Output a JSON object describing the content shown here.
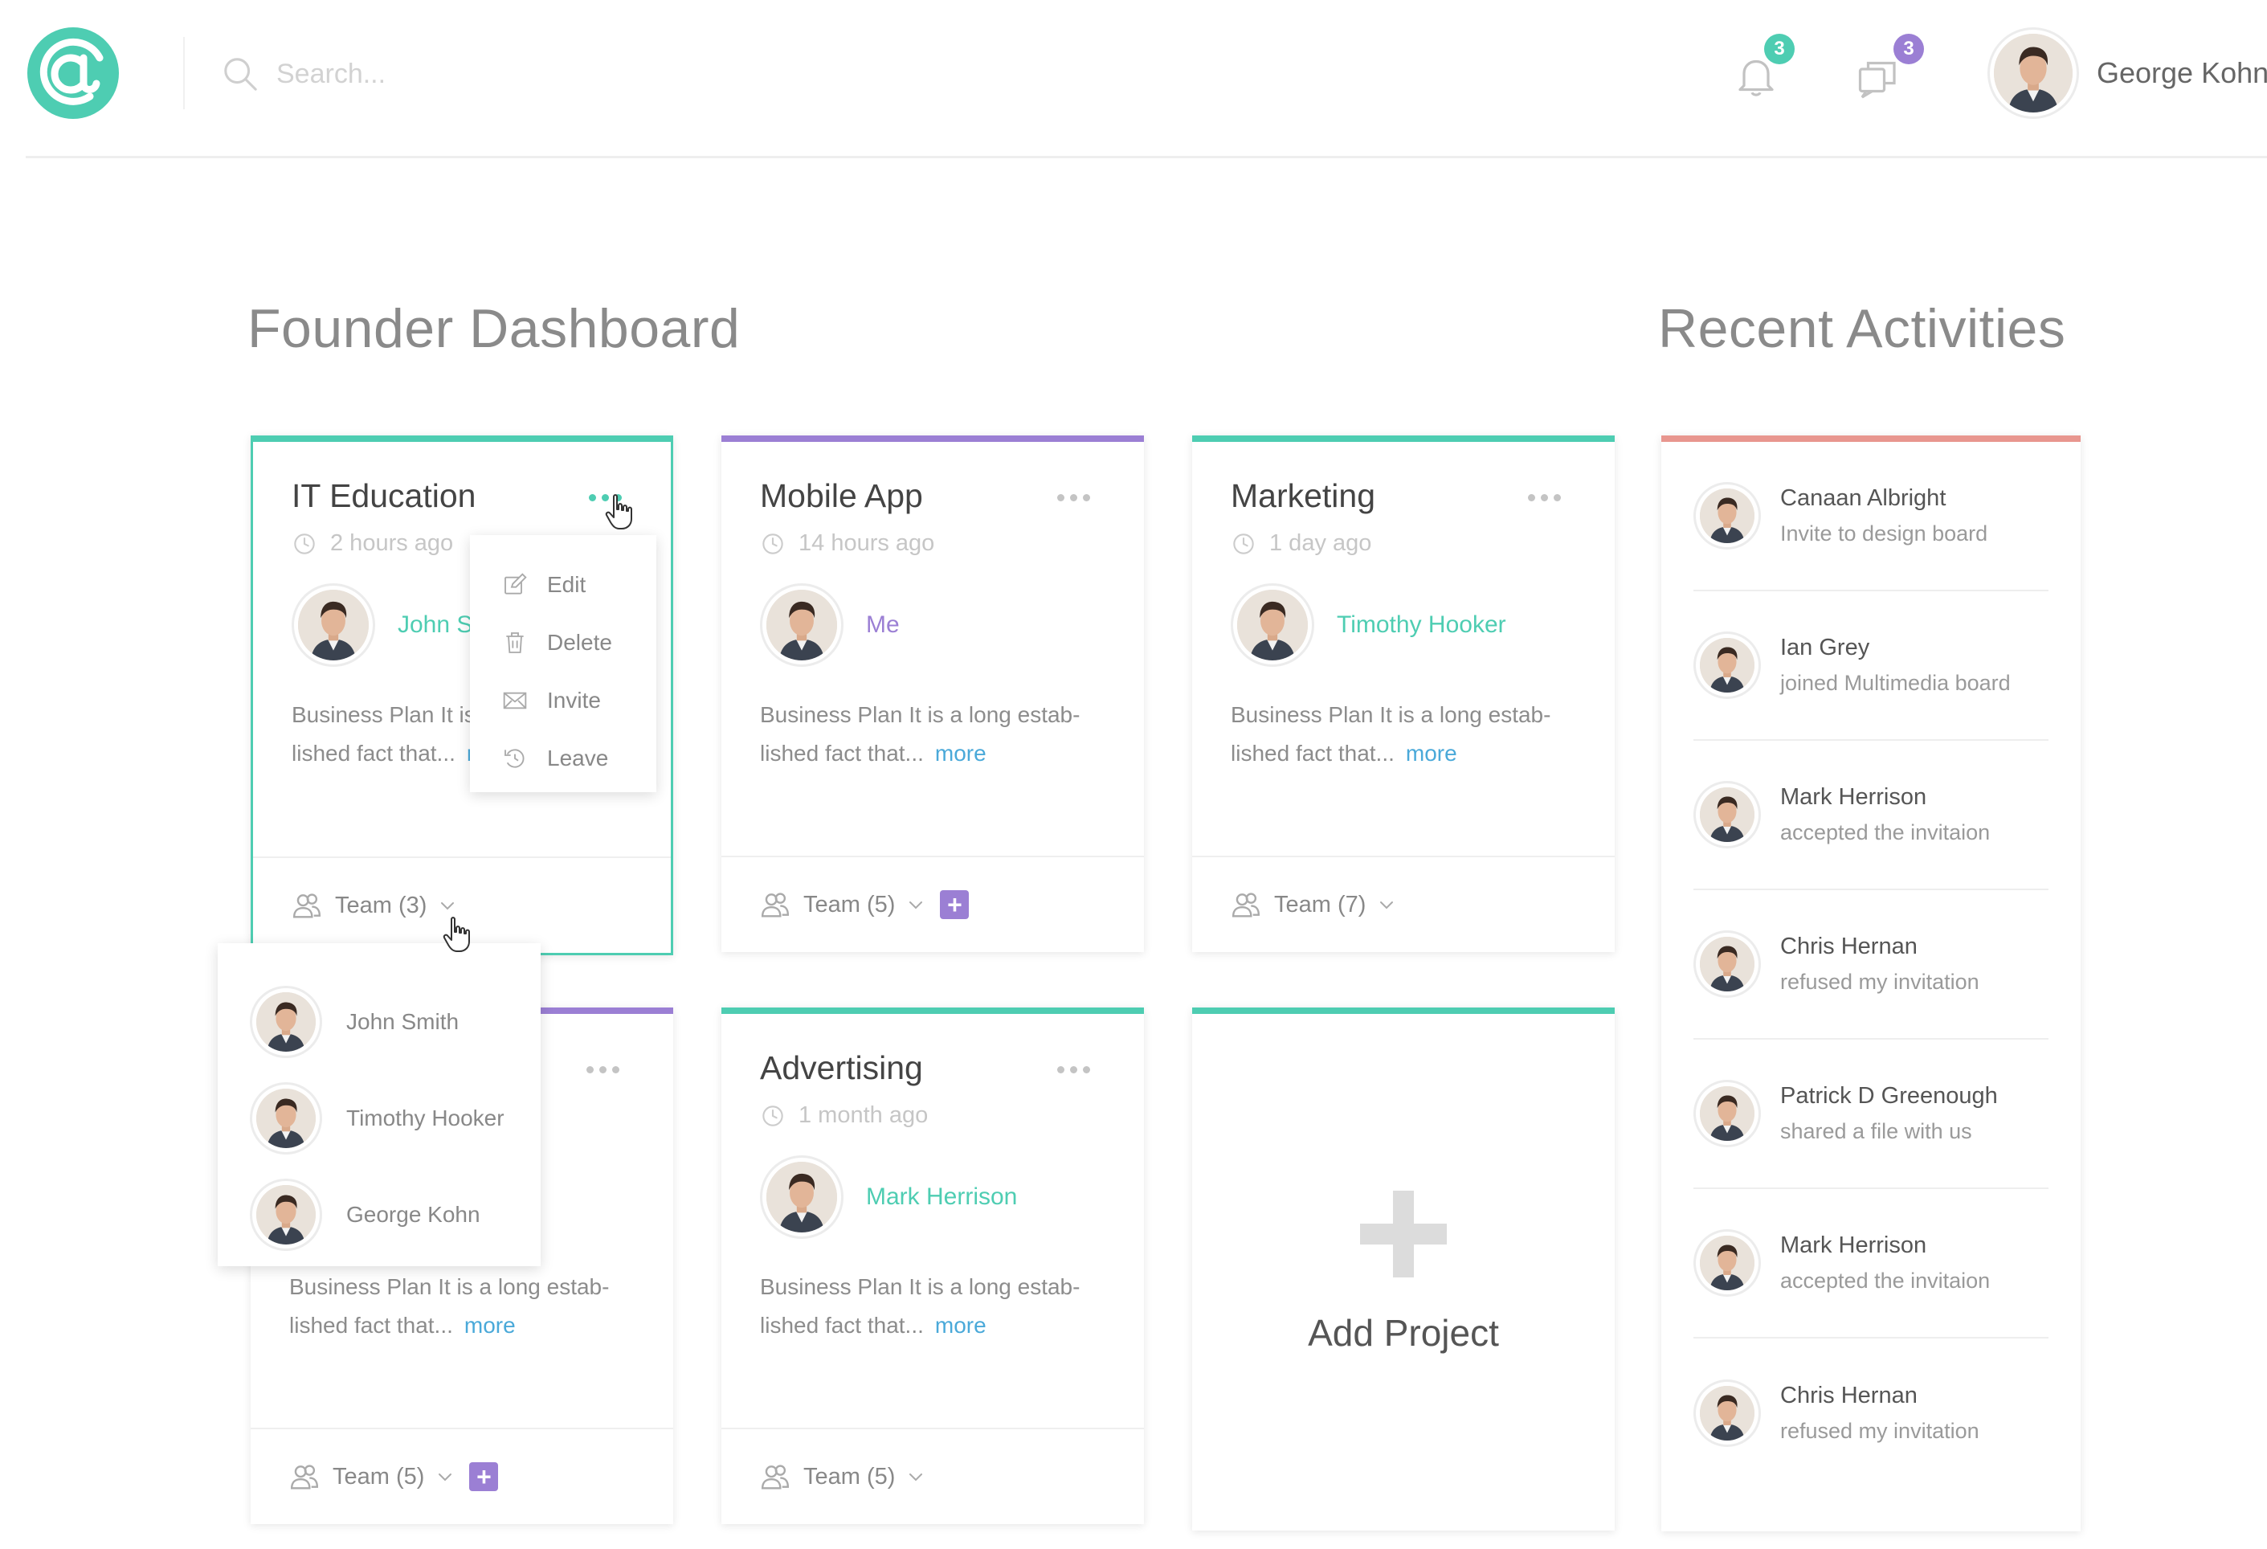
{
  "header": {
    "search_placeholder": "Search...",
    "notifications_count": "3",
    "messages_count": "3",
    "user_name": "George Kohn",
    "accent_color": "#4ecdb2",
    "badge_purple": "#9b7fd4"
  },
  "page": {
    "title": "Founder Dashboard",
    "activities_title": "Recent Activities"
  },
  "projects": [
    {
      "title": "IT Education",
      "time": "2 hours ago",
      "owner": "John Smith",
      "desc_line1": "Business Plan It is a long estab-",
      "desc_line2": "lished fact that...",
      "more": "more",
      "team": "Team (3)",
      "accent": "teal"
    },
    {
      "title": "Mobile App",
      "time": "14 hours ago",
      "owner": "Me",
      "desc_line1": "Business Plan It is a long estab-",
      "desc_line2": "lished fact that...",
      "more": "more",
      "team": "Team (5)",
      "accent": "purple"
    },
    {
      "title": "Marketing",
      "time": "1 day ago",
      "owner": "Timothy Hooker",
      "desc_line1": "Business Plan It is a long estab-",
      "desc_line2": "lished fact that...",
      "more": "more",
      "team": "Team (7)",
      "accent": "teal"
    },
    {
      "title": "",
      "time": "",
      "owner": "",
      "desc_line1": "Business Plan It is a long estab-",
      "desc_line2": "lished fact that...",
      "more": "more",
      "team": "Team (5)",
      "accent": "purple"
    },
    {
      "title": "Advertising",
      "time": "1 month ago",
      "owner": "Mark Herrison",
      "desc_line1": "Business Plan It is a long estab-",
      "desc_line2": "lished fact that...",
      "more": "more",
      "team": "Team (5)",
      "accent": "teal"
    }
  ],
  "card_menu": {
    "edit": "Edit",
    "delete": "Delete",
    "invite": "Invite",
    "leave": "Leave"
  },
  "team_dropdown": [
    "John Smith",
    "Timothy Hooker",
    "George Kohn"
  ],
  "add_project_label": "Add Project",
  "activities": [
    {
      "name": "Canaan Albright",
      "text": "Invite to design board"
    },
    {
      "name": "Ian Grey",
      "text": "joined Multimedia board"
    },
    {
      "name": "Mark Herrison",
      "text": "accepted the invitaion"
    },
    {
      "name": "Chris Hernan",
      "text": "refused my invitation"
    },
    {
      "name": "Patrick D Greenough",
      "text": "shared a file with us"
    },
    {
      "name": "Mark Herrison",
      "text": "accepted the invitaion"
    },
    {
      "name": "Chris Hernan",
      "text": "refused my invitation"
    }
  ]
}
